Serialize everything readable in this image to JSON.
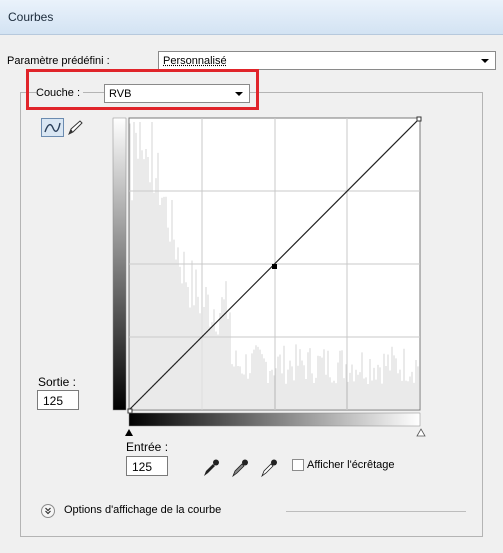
{
  "window": {
    "title": "Courbes"
  },
  "preset": {
    "label": "Paramètre prédéfini :",
    "value": "Personnalisé"
  },
  "channel": {
    "label": "Couche :",
    "value": "RVB"
  },
  "output": {
    "label": "Sortie :",
    "value": "125"
  },
  "input": {
    "label": "Entrée :",
    "value": "125"
  },
  "clipping": {
    "label": "Afficher l'écrêtage",
    "checked": false
  },
  "options": {
    "label": "Options d'affichage de la courbe"
  },
  "colors": {
    "highlight": "#e0242a",
    "titlebar": "#d3e3f3",
    "histogram": "#d6d6d6"
  },
  "icons": [
    "curve-mode-icon",
    "pencil-mode-icon",
    "black-point-eyedropper-icon",
    "gray-point-eyedropper-icon",
    "white-point-eyedropper-icon",
    "expand-chevron-icon"
  ],
  "curve": {
    "points": [
      [
        0,
        0
      ],
      [
        125,
        125
      ],
      [
        255,
        255
      ]
    ],
    "selected_point": [
      125,
      125
    ]
  }
}
